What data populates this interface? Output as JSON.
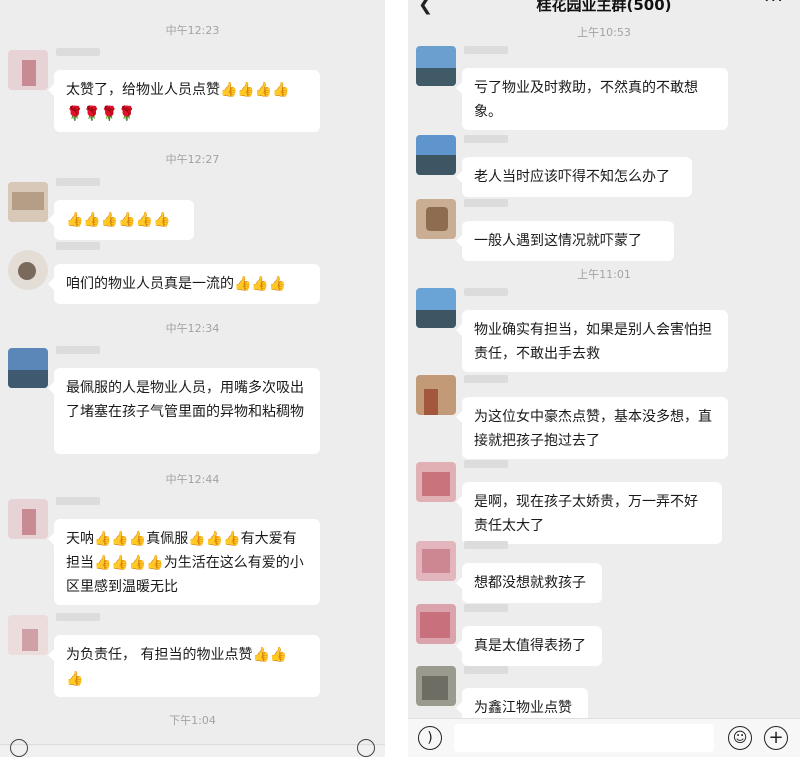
{
  "left": {
    "messages": [
      {
        "time": "中午12:23",
        "text": "太赞了，给物业人员点赞",
        "emojis": "👍👍👍👍",
        "line2": "🌹🌹🌹🌹"
      },
      {
        "time": "中午12:27",
        "text": "",
        "emojis": "👍👍👍👍👍👍"
      },
      {
        "text": "咱们的物业人员真是一流的",
        "emojis": "👍👍👍"
      },
      {
        "time": "中午12:34",
        "text": "最佩服的人是物业人员，用嘴多次吸出了堵塞在孩子气管里面的异物和粘稠物"
      },
      {
        "time": "中午12:44",
        "seg1": "天呐",
        "emo1": "👍👍👍",
        "seg2": "真佩服",
        "emo2": "👍👍👍",
        "seg3": "有大爱有担当",
        "emo3": "👍👍👍👍",
        "seg4": "为生活在这么有爱的小区里感到温暖无比"
      },
      {
        "text": "为负责任， 有担当的物业点赞",
        "emojis": "👍👍",
        "line2": "👍"
      }
    ],
    "last_time": "下午1:04"
  },
  "right": {
    "title": "桂花园业主群(500)",
    "back_icon": "chevron-left-icon",
    "more_icon": "more-dots-icon",
    "messages": [
      {
        "time": "上午10:53",
        "text": "亏了物业及时救助，不然真的不敢想象。"
      },
      {
        "text": "老人当时应该吓得不知怎么办了"
      },
      {
        "text": "一般人遇到这情况就吓蒙了"
      },
      {
        "time": "上午11:01",
        "text": "物业确实有担当，如果是别人会害怕担责任，不敢出手去救"
      },
      {
        "text": "为这位女中豪杰点赞，基本没多想，直接就把孩子抱过去了"
      },
      {
        "text": "是啊，现在孩子太娇贵，万一弄不好责任太大了"
      },
      {
        "text": "想都没想就救孩子"
      },
      {
        "text": "真是太值得表扬了"
      },
      {
        "text": "为鑫江物业点赞"
      }
    ]
  },
  "icons": {
    "voice": "voice-icon",
    "emoji": "emoji-icon",
    "plus": "plus-icon"
  },
  "colors": {
    "chat_bg": "#ededed",
    "bubble": "#ffffff",
    "timestamp": "#a3a3a3"
  }
}
